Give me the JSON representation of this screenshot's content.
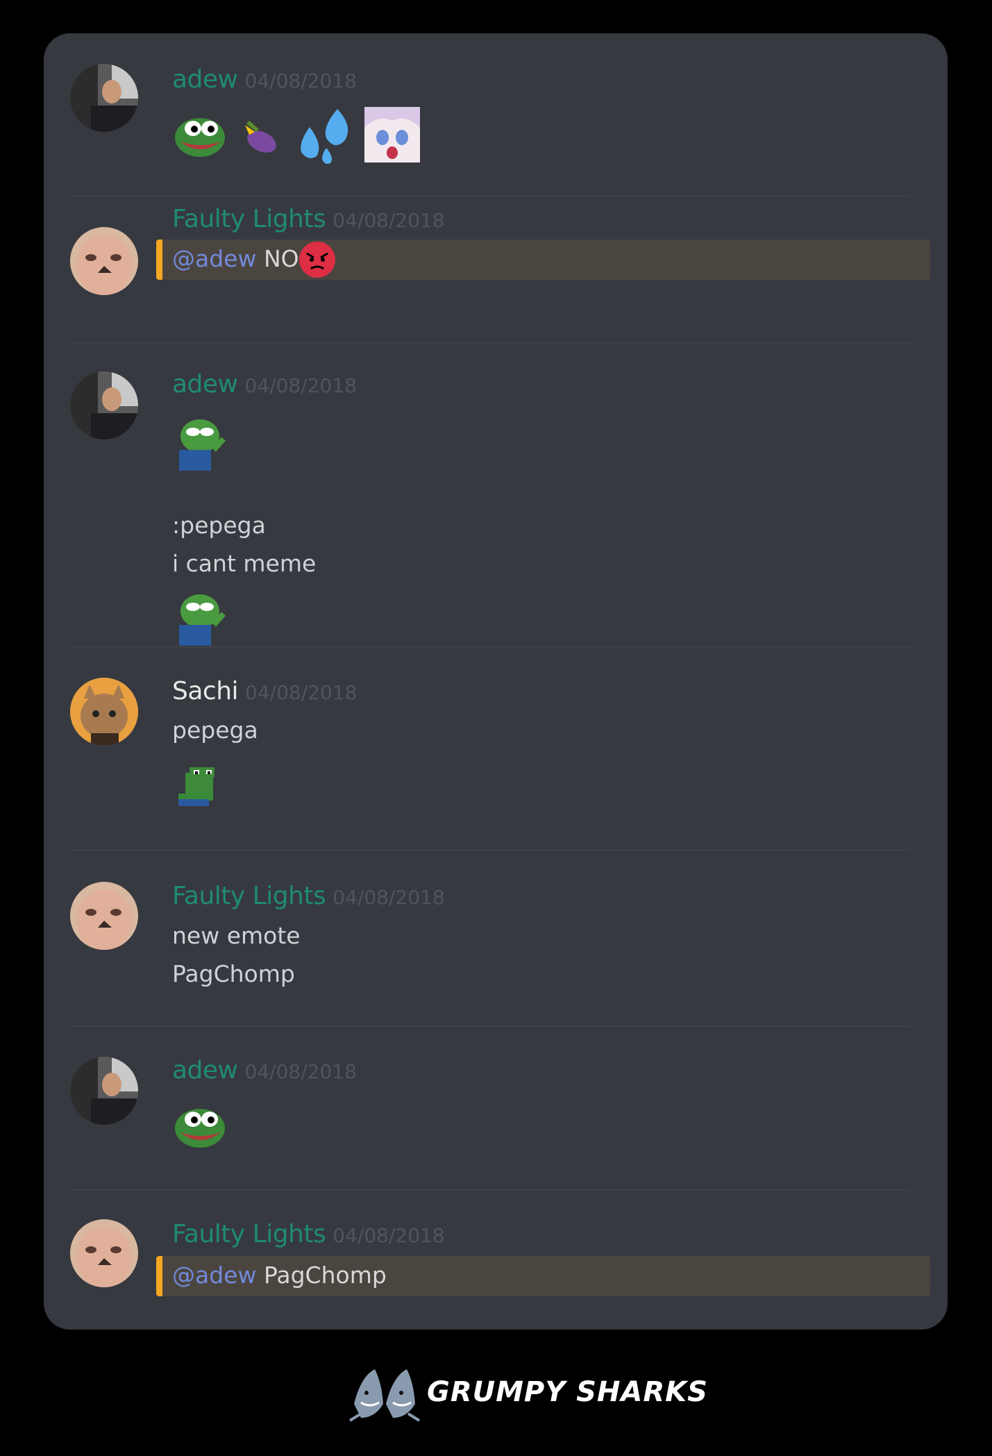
{
  "messages": [
    {
      "author": "adew",
      "timestamp": "04/08/2018",
      "lines": [],
      "emotes": [
        "pepe-happy",
        "eggplant-emoji",
        "sweat-drops-emoji",
        "anime-girl-shocked"
      ]
    },
    {
      "author": "Faulty Lights",
      "timestamp": "04/08/2018",
      "mention": "@adew",
      "mention_text": "NO",
      "mention_emoji": "angry-face-emoji"
    },
    {
      "author": "adew",
      "timestamp": "04/08/2018",
      "lines": [
        ":pepega",
        "i cant meme"
      ],
      "emotes": [
        "pepe-cry",
        "pepe-cry"
      ]
    },
    {
      "author": "Sachi",
      "timestamp": "04/08/2018",
      "lines": [
        "pepega"
      ],
      "emotes": [
        "pepe-pixel"
      ]
    },
    {
      "author": "Faulty Lights",
      "timestamp": "04/08/2018",
      "lines": [
        "new emote",
        "PagChomp"
      ]
    },
    {
      "author": "adew",
      "timestamp": "04/08/2018",
      "lines": [],
      "emotes": [
        "pepe-happy"
      ]
    },
    {
      "author": "Faulty Lights",
      "timestamp": "04/08/2018",
      "mention": "@adew",
      "mention_text": "PagChomp"
    }
  ],
  "footer": {
    "brand": "GRUMPY SHARKS",
    "logo": "shark-logo-icon"
  },
  "colors": {
    "background": "#000000",
    "panel": "#36393f",
    "username_green": "#1f8b73",
    "mention_bar": "#4b4540",
    "mention_accent": "#f5a623",
    "mention_text": "#7289da"
  }
}
